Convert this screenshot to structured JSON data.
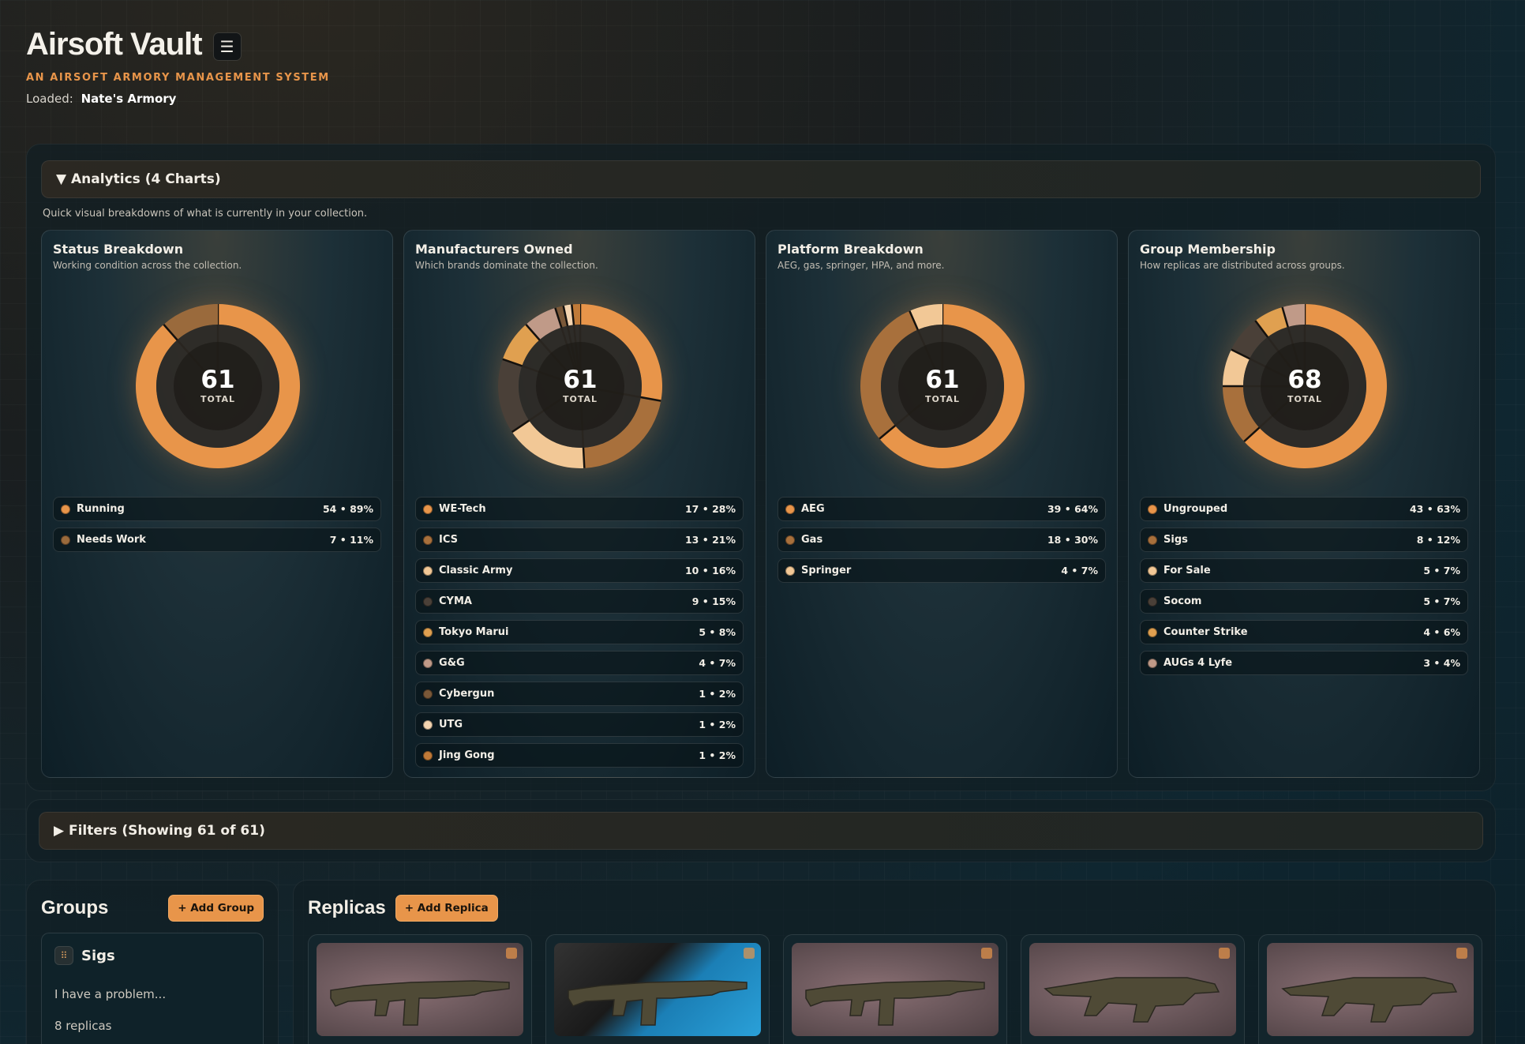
{
  "header": {
    "title": "Airsoft Vault",
    "menu_icon": "☰",
    "subtitle": "AN AIRSOFT ARMORY MANAGEMENT SYSTEM",
    "loaded_label": "Loaded:",
    "loaded_value": "Nate's Armory"
  },
  "analytics": {
    "toggle_label": "▼ Analytics (4 Charts)",
    "note": "Quick visual breakdowns of what is currently in your collection.",
    "total_label": "TOTAL",
    "charts": [
      {
        "title": "Status Breakdown",
        "subtitle": "Working condition across the collection.",
        "total": "61",
        "items": [
          {
            "name": "Running",
            "count": 54,
            "value": "54 • 89%",
            "color": "#e8954a"
          },
          {
            "name": "Needs Work",
            "count": 7,
            "value": "7 • 11%",
            "color": "#9a6a3c"
          }
        ]
      },
      {
        "title": "Manufacturers Owned",
        "subtitle": "Which brands dominate the collection.",
        "total": "61",
        "items": [
          {
            "name": "WE-Tech",
            "count": 17,
            "value": "17 • 28%",
            "color": "#e8954a"
          },
          {
            "name": "ICS",
            "count": 13,
            "value": "13 • 21%",
            "color": "#a8703c"
          },
          {
            "name": "Classic Army",
            "count": 10,
            "value": "10 • 16%",
            "color": "#f2c896"
          },
          {
            "name": "CYMA",
            "count": 9,
            "value": "9 • 15%",
            "color": "#4a4038"
          },
          {
            "name": "Tokyo Marui",
            "count": 5,
            "value": "5 • 8%",
            "color": "#e0a050"
          },
          {
            "name": "G&G",
            "count": 4,
            "value": "4 • 7%",
            "color": "#c09a88"
          },
          {
            "name": "Cybergun",
            "count": 1,
            "value": "1 • 2%",
            "color": "#7a5838"
          },
          {
            "name": "UTG",
            "count": 1,
            "value": "1 • 2%",
            "color": "#f4d4b0"
          },
          {
            "name": "Jing Gong",
            "count": 1,
            "value": "1 • 2%",
            "color": "#c07a38"
          }
        ]
      },
      {
        "title": "Platform Breakdown",
        "subtitle": "AEG, gas, springer, HPA, and more.",
        "total": "61",
        "items": [
          {
            "name": "AEG",
            "count": 39,
            "value": "39 • 64%",
            "color": "#e8954a"
          },
          {
            "name": "Gas",
            "count": 18,
            "value": "18 • 30%",
            "color": "#a8703c"
          },
          {
            "name": "Springer",
            "count": 4,
            "value": "4 • 7%",
            "color": "#f2c896"
          }
        ]
      },
      {
        "title": "Group Membership",
        "subtitle": "How replicas are distributed across groups.",
        "total": "68",
        "items": [
          {
            "name": "Ungrouped",
            "count": 43,
            "value": "43 • 63%",
            "color": "#e8954a"
          },
          {
            "name": "Sigs",
            "count": 8,
            "value": "8 • 12%",
            "color": "#a8703c"
          },
          {
            "name": "For Sale",
            "count": 5,
            "value": "5 • 7%",
            "color": "#f2c896"
          },
          {
            "name": "Socom",
            "count": 5,
            "value": "5 • 7%",
            "color": "#4a4038"
          },
          {
            "name": "Counter Strike",
            "count": 4,
            "value": "4 • 6%",
            "color": "#e0a050"
          },
          {
            "name": "AUGs 4 Lyfe",
            "count": 3,
            "value": "3 • 4%",
            "color": "#c09a88"
          }
        ]
      }
    ]
  },
  "filters": {
    "toggle_label": "▶ Filters (Showing 61 of 61)"
  },
  "groups": {
    "heading": "Groups",
    "add_label": "+ Add Group",
    "first_group": {
      "name": "Sigs",
      "description": "I have a problem...",
      "count": "8 replicas"
    }
  },
  "replicas": {
    "heading": "Replicas",
    "add_label": "+ Add Replica",
    "cards": [
      {
        "icon": "rifle-photo",
        "style": "cloth"
      },
      {
        "icon": "rifle-photo",
        "style": "blue"
      },
      {
        "icon": "rifle-photo",
        "style": "cloth"
      },
      {
        "icon": "bullpup-photo",
        "style": "cloth"
      },
      {
        "icon": "bullpup-photo",
        "style": "cloth"
      }
    ]
  }
}
